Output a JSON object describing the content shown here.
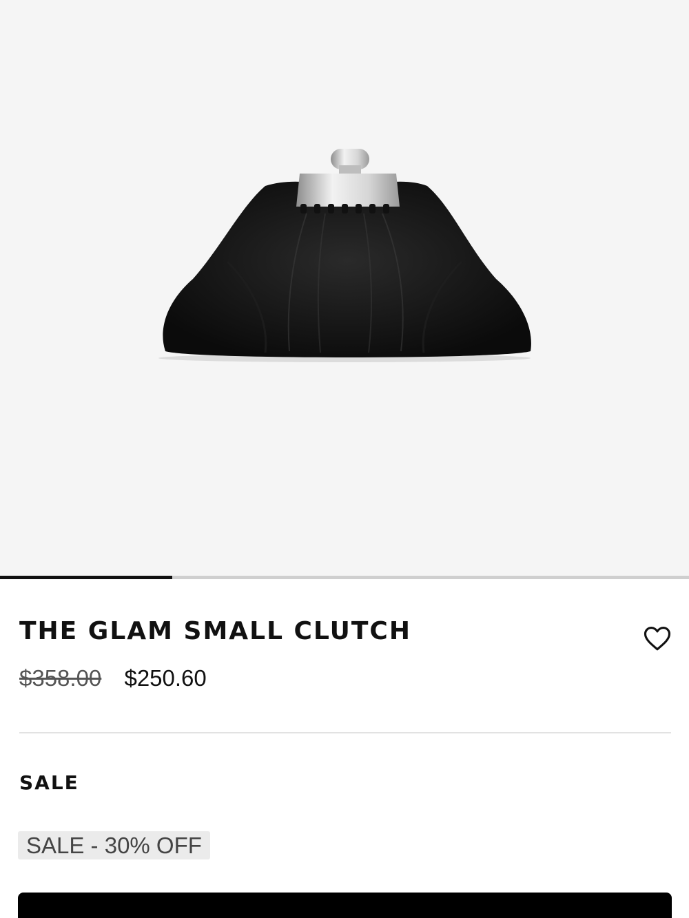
{
  "gallery": {
    "image_alt": "",
    "progress_fraction": 0.25
  },
  "product": {
    "title": "THE GLAM SMALL CLUTCH",
    "original_price": "$358.00",
    "sale_price": "$250.60",
    "wishlist_icon": "heart-icon"
  },
  "promotions": {
    "section_label": "SALE",
    "badge_text": "SALE - 30% OFF"
  },
  "cta": {
    "label": ""
  },
  "colors": {
    "background": "#ffffff",
    "gallery_background": "#f5f5f5",
    "text": "#111111",
    "strike_price": "#555555",
    "badge_background": "#ebebeb",
    "cta_background": "#000000"
  }
}
